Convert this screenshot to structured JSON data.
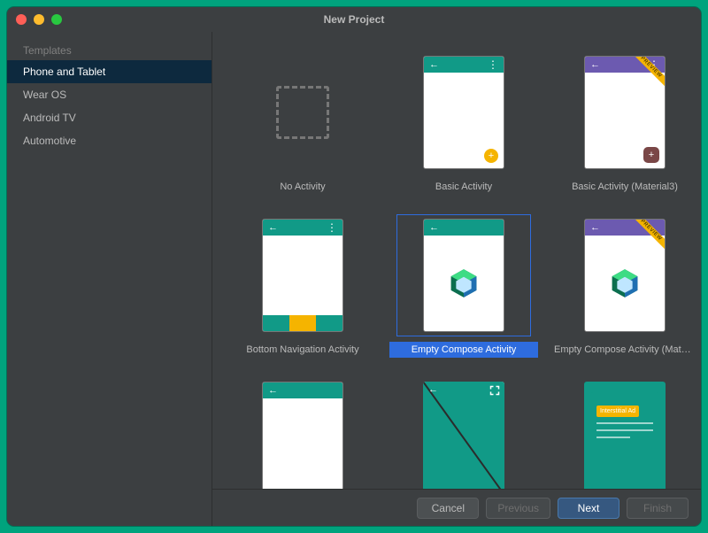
{
  "window": {
    "title": "New Project"
  },
  "sidebar": {
    "heading": "Templates",
    "items": [
      {
        "label": "Phone and Tablet",
        "selected": true
      },
      {
        "label": "Wear OS"
      },
      {
        "label": "Android TV"
      },
      {
        "label": "Automotive"
      }
    ]
  },
  "templates": [
    {
      "label": "No Activity"
    },
    {
      "label": "Basic Activity"
    },
    {
      "label": "Basic Activity (Material3)",
      "preview": true
    },
    {
      "label": "Bottom Navigation Activity"
    },
    {
      "label": "Empty Compose Activity",
      "selected": true
    },
    {
      "label": "Empty Compose Activity (Materi...",
      "preview": true
    },
    {
      "label": ""
    },
    {
      "label": ""
    },
    {
      "label": "",
      "ad_text": "Interstitial Ad"
    }
  ],
  "preview_badge": "PREVIEW",
  "footer": {
    "cancel": "Cancel",
    "previous": "Previous",
    "next": "Next",
    "finish": "Finish"
  }
}
